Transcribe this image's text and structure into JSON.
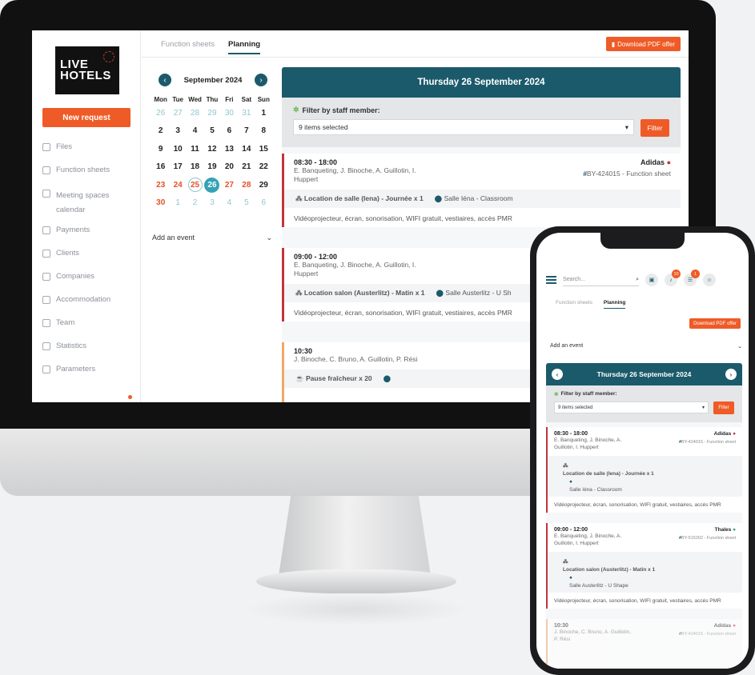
{
  "brand": {
    "line1": "LIVE",
    "line2": "HOTELS"
  },
  "sidebar": {
    "new_request": "New request",
    "items": [
      {
        "label": "Files"
      },
      {
        "label": "Function sheets"
      },
      {
        "label": "Meeting spaces calendar"
      },
      {
        "label": "Payments"
      },
      {
        "label": "Clients"
      },
      {
        "label": "Companies"
      },
      {
        "label": "Accommodation"
      },
      {
        "label": "Team"
      },
      {
        "label": "Statistics"
      },
      {
        "label": "Parameters"
      }
    ]
  },
  "tabs": {
    "function_sheets": "Function sheets",
    "planning": "Planning"
  },
  "download_pdf": "Download PDF offer",
  "calendar": {
    "title": "September 2024",
    "prev": "‹",
    "next": "›",
    "dow": [
      "Mon",
      "Tue",
      "Wed",
      "Thu",
      "Fri",
      "Sat",
      "Sun"
    ],
    "weeks": [
      [
        "26",
        "27",
        "28",
        "29",
        "30",
        "31",
        "1"
      ],
      [
        "2",
        "3",
        "4",
        "5",
        "6",
        "7",
        "8"
      ],
      [
        "9",
        "10",
        "11",
        "12",
        "13",
        "14",
        "15"
      ],
      [
        "16",
        "17",
        "18",
        "19",
        "20",
        "21",
        "22"
      ],
      [
        "23",
        "24",
        "25",
        "26",
        "27",
        "28",
        "29"
      ],
      [
        "30",
        "1",
        "2",
        "3",
        "4",
        "5",
        "6"
      ]
    ]
  },
  "add_event": "Add an event",
  "planning": {
    "date_title": "Thursday 26 September 2024",
    "filter_label": "Filter by staff member:",
    "selected": "9 items selected",
    "filter_button": "Filter",
    "events": [
      {
        "time": "08:30 - 18:00",
        "staff": "E. Banqueting, J. Binoche, A. Guillotin, I. Huppert",
        "client": "Adidas",
        "ref": "BY-424015 - Function sheet",
        "room": "Location de salle (Iena) - Journée x 1",
        "venue": "Salle Iéna - Classroom",
        "equipment": "Vidéoprojecteur, écran, sonorisation, WIFI gratuit, vestiaires, accès PMR"
      },
      {
        "time": "09:00 - 12:00",
        "staff": "E. Banqueting, J. Binoche, A. Guillotin, I. Huppert",
        "room": "Location salon (Austerlitz) - Matin x 1",
        "venue": "Salle Austerlitz - U Sh",
        "equipment": "Vidéoprojecteur, écran, sonorisation, WIFI gratuit, vestiaires, accès PMR"
      },
      {
        "time": "10:30",
        "staff": "J. Binoche, C. Bruno, A. Guillotin, P. Rési",
        "room": "Pause fraîcheur x 20"
      }
    ]
  },
  "phone": {
    "search_placeholder": "Search...",
    "badge_bell": "10",
    "badge_list": "1",
    "venue1": "Salle Iéna - Classroom",
    "staff1": "E. Banqueting, J. Binoche, A. Guillotin, I. Huppert",
    "staff2": "E. Banqueting, J. Binoche, A. Guillotin, I. Huppert",
    "client2": "Thales",
    "ref2": "BY-515202 - Function sheet",
    "venue2": "Salle Austerlitz - U Shape",
    "staff3": "J. Binoche, C. Bruno, A. Guillotin, P. Rési",
    "client3": "Adidas",
    "ref3": "BY-424015 - Function sheet"
  },
  "colors": {
    "accent": "#ef5b27",
    "primary": "#1b5a6b",
    "today": "#35a2b6",
    "event_bar": "#c1343f"
  }
}
